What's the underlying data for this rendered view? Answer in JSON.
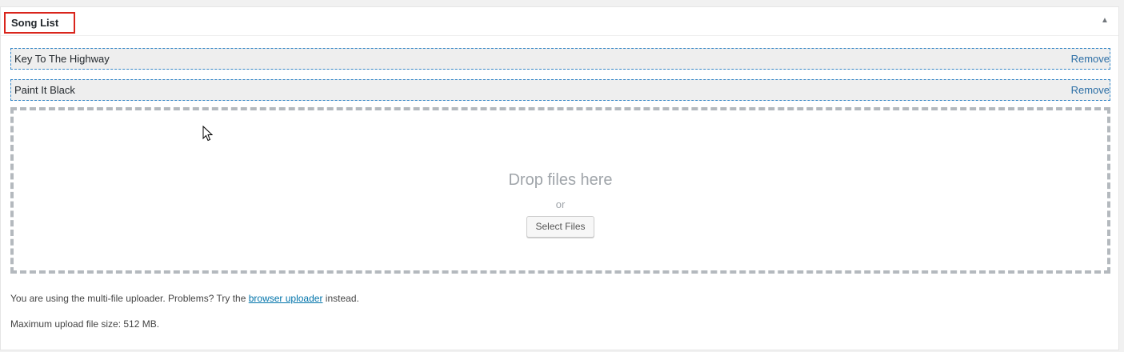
{
  "metabox": {
    "title": "Song List",
    "toggle_icon": "triangle-up-icon"
  },
  "songs": [
    {
      "name": "Key To The Highway",
      "action": "Remove"
    },
    {
      "name": "Paint It Black",
      "action": "Remove"
    }
  ],
  "uploader": {
    "drop_text": "Drop files here",
    "or_text": "or",
    "select_button": "Select Files",
    "notice_prefix": "You are using the multi-file uploader. Problems? Try the",
    "notice_link": "browser uploader",
    "notice_suffix": "instead.",
    "max_size": "Maximum upload file size: 512 MB."
  },
  "colors": {
    "title_highlight": "#d9251c",
    "link": "#2c6ea5",
    "row_border": "#3386c7",
    "dropzone_border": "#b4b9be"
  }
}
